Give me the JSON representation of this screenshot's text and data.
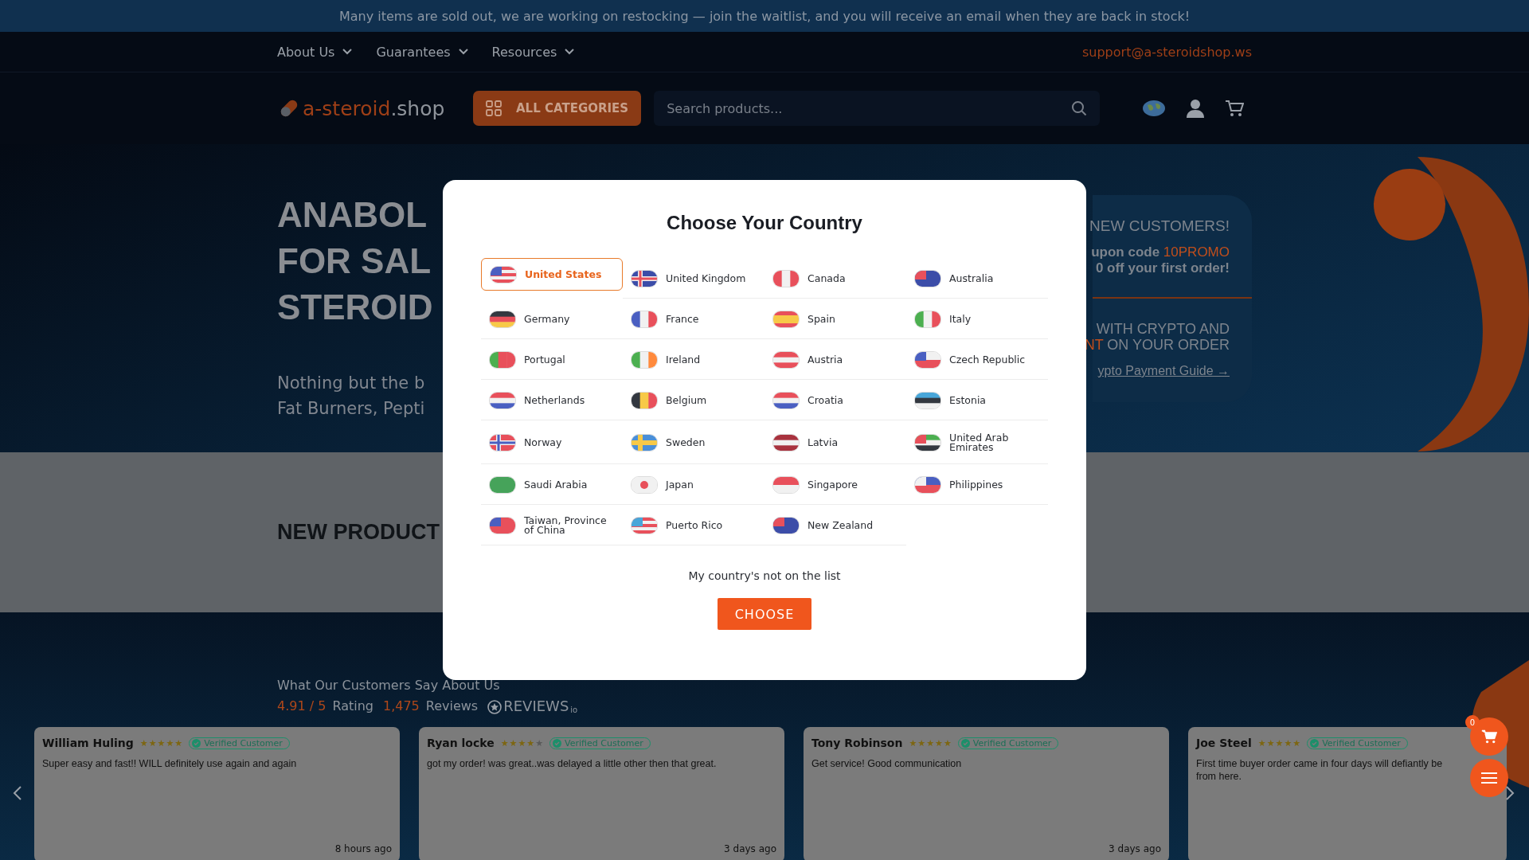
{
  "announcement": "Many items are sold out, we are working on restocking — join the waitlist, and you will receive an email when they are back in stock!",
  "nav": {
    "items": [
      "About Us",
      "Guarantees",
      "Resources"
    ],
    "email": "support@a-steroidshop.ws"
  },
  "header": {
    "logo": {
      "brand": "a-steroid",
      "tld": ".shop"
    },
    "categories_button": "ALL CATEGORIES",
    "search": {
      "placeholder": "Search products..."
    }
  },
  "hero": {
    "heading": [
      "ANABOL",
      "FOR SAL",
      "STEROID"
    ],
    "subtitle": [
      "Nothing but the b",
      "Fat Burners, Pepti"
    ],
    "promo": {
      "title": "NEW CUSTOMERS!",
      "lines": [
        [
          {
            "text": "upon code ",
            "accent": false
          },
          {
            "text": "10PROMO",
            "accent": true
          }
        ],
        [
          {
            "text": "0 off your first order!",
            "accent": false
          }
        ]
      ],
      "crypto": [
        [
          {
            "text": "WITH CRYPTO AND",
            "accent": false
          }
        ],
        [
          {
            "text": "NT",
            "accent": true
          },
          {
            "text": " ON YOUR ORDER",
            "accent": false
          }
        ]
      ],
      "link": "ypto Payment Guide →"
    }
  },
  "new_products": {
    "title": "NEW PRODUCT"
  },
  "reviews": {
    "title": "What Our Customers Say About Us",
    "score": "4.91 / 5",
    "score_label": "Rating",
    "count": "1,475",
    "count_label": "Reviews",
    "provider": "REVIEWS",
    "provider_suffix": "io",
    "cards": [
      {
        "name": "William Huling",
        "stars": 5,
        "badge": "Verified Customer",
        "lines": [
          "Super easy and fast!! WILL definitely use again and again"
        ],
        "time": "8 hours ago"
      },
      {
        "name": "Ryan locke",
        "stars": 4,
        "badge": "Verified Customer",
        "lines": [
          "got my order! was great..was delayed a little other then that great."
        ],
        "time": "3 days ago"
      },
      {
        "name": "Tony Robinson",
        "stars": 5,
        "badge": "Verified Customer",
        "lines": [
          "Get service! Good communication"
        ],
        "time": "3 days ago"
      },
      {
        "name": "Joe Steel",
        "stars": 5,
        "badge": "Verified Customer",
        "lines": [
          "First time buyer order came in four days will defiantly be",
          "from here."
        ]
      }
    ]
  },
  "floating": {
    "cart_count": "0"
  },
  "modal": {
    "title": "Choose Your Country",
    "countries": [
      {
        "name": "United States",
        "selected": true
      },
      {
        "name": "United Kingdom",
        "selected": false
      },
      {
        "name": "Canada",
        "selected": false
      },
      {
        "name": "Australia",
        "selected": false
      },
      {
        "name": "Germany",
        "selected": false
      },
      {
        "name": "France",
        "selected": false
      },
      {
        "name": "Spain",
        "selected": false
      },
      {
        "name": "Italy",
        "selected": false
      },
      {
        "name": "Portugal",
        "selected": false
      },
      {
        "name": "Ireland",
        "selected": false
      },
      {
        "name": "Austria",
        "selected": false
      },
      {
        "name": "Czech Republic",
        "selected": false
      },
      {
        "name": "Netherlands",
        "selected": false
      },
      {
        "name": "Belgium",
        "selected": false
      },
      {
        "name": "Croatia",
        "selected": false
      },
      {
        "name": "Estonia",
        "selected": false
      },
      {
        "name": "Norway",
        "selected": false
      },
      {
        "name": "Sweden",
        "selected": false
      },
      {
        "name": "Latvia",
        "selected": false
      },
      {
        "name": "United Arab Emirates",
        "selected": false
      },
      {
        "name": "Saudi Arabia",
        "selected": false
      },
      {
        "name": "Japan",
        "selected": false
      },
      {
        "name": "Singapore",
        "selected": false
      },
      {
        "name": "Philippines",
        "selected": false
      },
      {
        "name": "Taiwan, Province of China",
        "selected": false
      },
      {
        "name": "Puerto Rico",
        "selected": false
      },
      {
        "name": "New Zealand",
        "selected": false
      }
    ],
    "not_listed": "My country's not on the list",
    "button": "CHOOSE"
  }
}
